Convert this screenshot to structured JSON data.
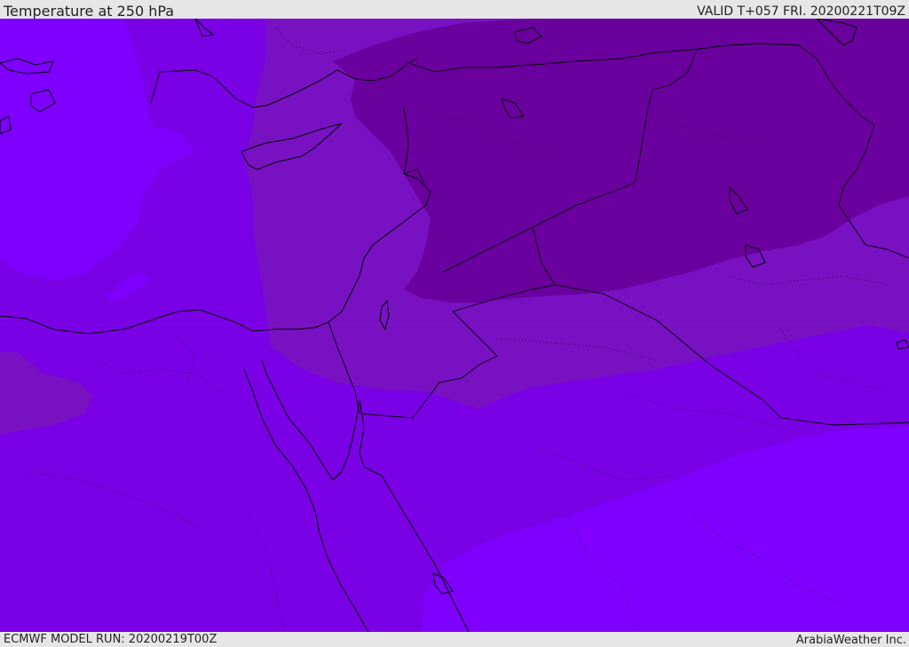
{
  "header": {
    "title": "Temperature at 250 hPa",
    "valid": "VALID T+057 FRI. 20200221T09Z"
  },
  "footer": {
    "model_run": "ECMWF MODEL RUN: 20200219T00Z",
    "credit": "ArabiaWeather Inc."
  },
  "map": {
    "colors": {
      "level_cold": "#7f00ff",
      "level_mid": "#7a00e6",
      "level_warm": "#7811c2",
      "level_warmest": "#6a009e",
      "coastline": "#000000",
      "border": "#000000"
    }
  }
}
